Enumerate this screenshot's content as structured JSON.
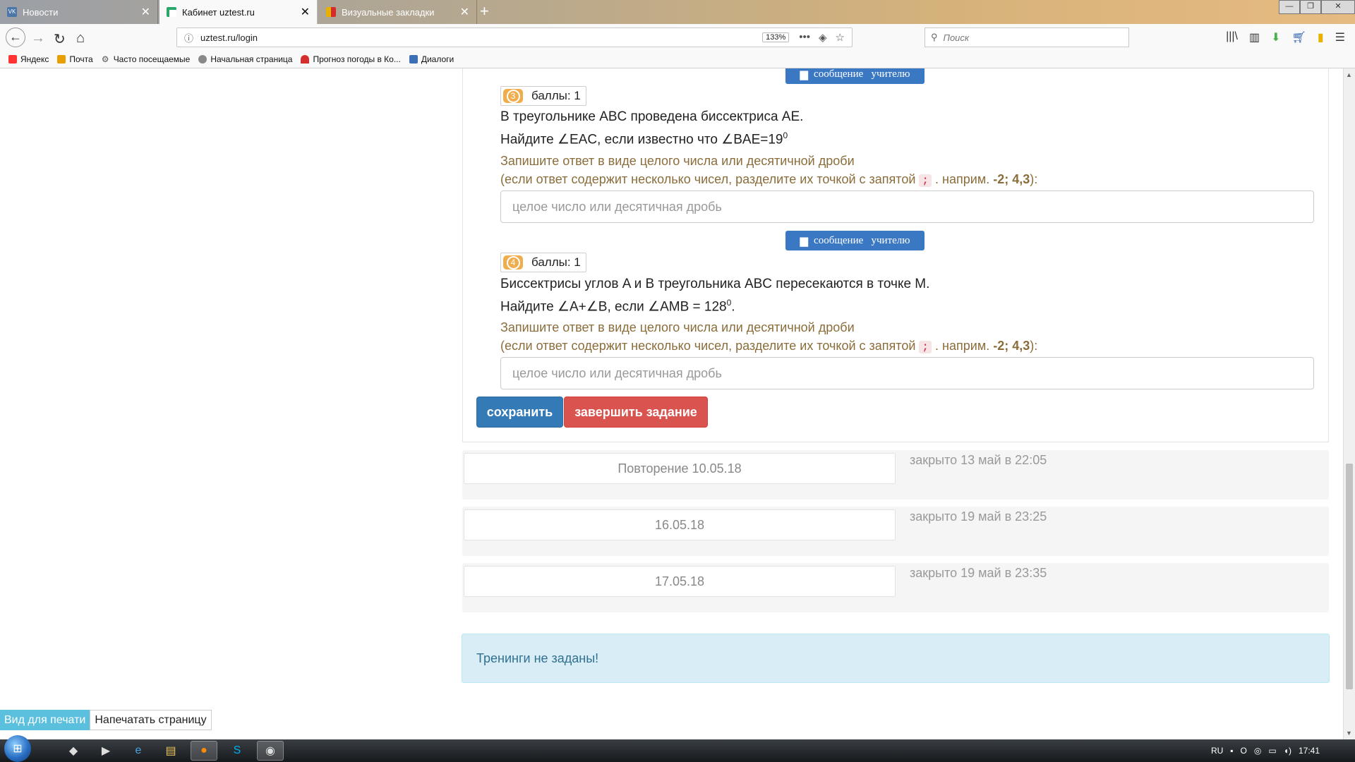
{
  "browser": {
    "tabs": [
      {
        "label": "Новости",
        "favicon_color": "#4a76a8",
        "favicon_text": "VK",
        "active": false
      },
      {
        "label": "Кабинет uztest.ru",
        "favicon_color": "#2aa86b",
        "favicon_text": "T",
        "active": true
      },
      {
        "label": "Визуальные закладки",
        "favicon_color": "#e8b100",
        "favicon_text": "",
        "active": false
      }
    ],
    "url": "uztest.ru/login",
    "zoom": "133%",
    "search_placeholder": "Поиск",
    "bookmarks": [
      {
        "label": "Яндекс",
        "color": "#ff3333"
      },
      {
        "label": "Почта",
        "color": "#e8a000"
      },
      {
        "label": "Часто посещаемые",
        "color": "#555555"
      },
      {
        "label": "Начальная страница",
        "color": "#777777"
      },
      {
        "label": "Прогноз погоды в Ко...",
        "color": "#d32f2f"
      },
      {
        "label": "Диалоги",
        "color": "#3d6fb5"
      }
    ]
  },
  "page": {
    "message_button_label": "сообщение   учителю",
    "questions": [
      {
        "number": "3",
        "points": "баллы: 1",
        "line1": "В треугольнике ABC проведена биссектриса AE.",
        "line2": "Найдите ∠EAC, если известно что ∠BAE=19",
        "line2_sup": "0",
        "line2_end": "",
        "answer_placeholder": "целое число или десятичная дробь"
      },
      {
        "number": "4",
        "points": "баллы: 1",
        "line1": "Биссектрисы углов A и B треугольника ABC пересекаются в точке M.",
        "line2": "Найдите ∠A+∠B, если ∠AMB = 128",
        "line2_sup": "0",
        "line2_end": ".",
        "answer_placeholder": "целое число или десятичная дробь"
      }
    ],
    "instruction": {
      "line1": "Запишите ответ в виде целого числа или десятичной дроби",
      "line2_pre": "(если ответ содержит несколько чисел, разделите их точкой с запятой",
      "semicolon": ";",
      "line2_mid": ". наприм.",
      "example": "-2; 4,3",
      "line2_end": "):"
    },
    "save_label": "сохранить",
    "finish_label": "завершить задание",
    "assignments": [
      {
        "name": "Повторение 10.05.18",
        "status": "закрыто 13 май в 22:05"
      },
      {
        "name": "16.05.18",
        "status": "закрыто 19 май в 23:25"
      },
      {
        "name": "17.05.18",
        "status": "закрыто 19 май в 23:35"
      }
    ],
    "alert": "Тренинги не заданы!",
    "print_view": "Вид для печати",
    "print_page": "Напечатать страницу"
  },
  "taskbar": {
    "lang": "RU",
    "time": "17:41"
  }
}
